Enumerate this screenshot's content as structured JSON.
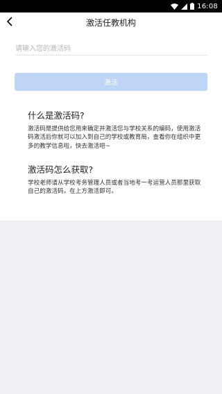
{
  "status_bar": {
    "time": "16:08",
    "icons": [
      "wifi-icon",
      "signal-icon",
      "battery-icon"
    ]
  },
  "header": {
    "title": "激活任教机构",
    "back_icon": "chevron-left-icon"
  },
  "form": {
    "placeholder": "请输入您的激活码",
    "value": "",
    "submit_label": "激活"
  },
  "help": {
    "what_title": "什么是激活码?",
    "what_body": "激活码是提供给您用来确定并激活您与学校关系的编码，使用激活码激活后你就可以加入到自己的学校或教育局，查看你在组织中更多的教学信息啦，快去激活吧~",
    "how_title": "激活码怎么获取?",
    "how_body": "学校老师请从学校考务管理人员或者当地考一考运营人员那里获取自己的激活码，在上方激活即可。"
  },
  "colors": {
    "button_disabled": "#bfd5f7",
    "background": "#efeff4"
  }
}
